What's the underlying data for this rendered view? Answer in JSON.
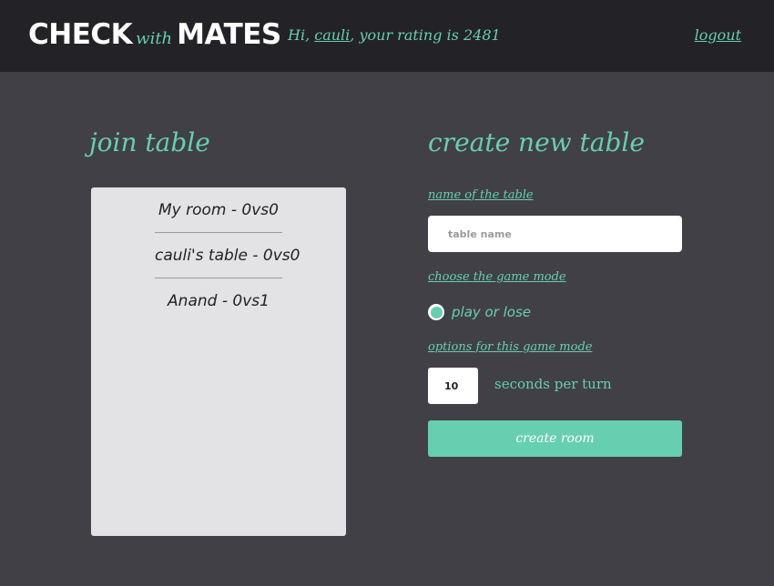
{
  "header": {
    "logo": {
      "part1": "CHECK",
      "part2": "with",
      "part3": "MATES"
    },
    "greeting_prefix": "Hi, ",
    "username": "cauli",
    "greeting_suffix": ", your rating is 2481",
    "logout_label": "logout"
  },
  "join": {
    "title": "join table",
    "rooms": [
      {
        "label": "My room - 0vs0"
      },
      {
        "label": "cauli's table - 0vs0"
      },
      {
        "label": "Anand - 0vs1"
      }
    ]
  },
  "create": {
    "title": "create new table",
    "name_label": "name of the table",
    "name_placeholder": "table name",
    "name_value": "",
    "mode_label": "choose the game mode",
    "mode_option": "play or lose",
    "options_label": "options for this game mode",
    "seconds_value": "10",
    "seconds_label": "seconds per turn",
    "button_label": "create room"
  },
  "colors": {
    "accent": "#66cfb0",
    "header_bg": "#232226",
    "page_bg": "#414046",
    "panel_bg": "#e3e2e4"
  }
}
